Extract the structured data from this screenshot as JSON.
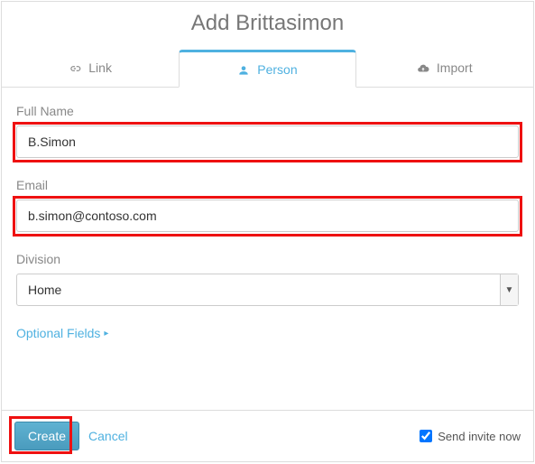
{
  "title": "Add Brittasimon",
  "tabs": {
    "link": {
      "label": "Link"
    },
    "person": {
      "label": "Person"
    },
    "import": {
      "label": "Import"
    }
  },
  "fields": {
    "full_name": {
      "label": "Full Name",
      "value": "B.Simon"
    },
    "email": {
      "label": "Email",
      "value": "b.simon@contoso.com"
    },
    "division": {
      "label": "Division",
      "value": "Home"
    }
  },
  "optional_link": "Optional Fields",
  "footer": {
    "create": "Create",
    "cancel": "Cancel",
    "send_invite": "Send invite now",
    "send_invite_checked": true
  },
  "colors": {
    "accent": "#4fb1e0",
    "highlight": "#e11"
  }
}
